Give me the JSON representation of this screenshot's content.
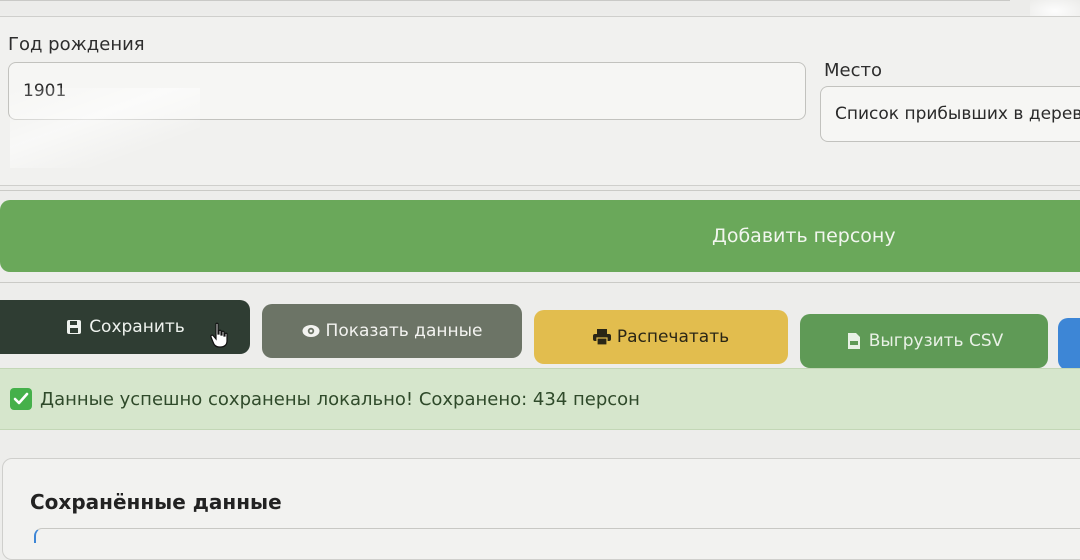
{
  "form": {
    "birth_year_label": "Год рождения",
    "birth_year_value": "1901",
    "place_label": "Место",
    "place_value": "Список прибывших в деревн"
  },
  "actions": {
    "add_person": "Добавить персону",
    "save": "Сохранить",
    "show_data": "Показать данные",
    "print": "Распечатать",
    "export_csv": "Выгрузить CSV"
  },
  "status": {
    "message": "Данные успешно сохранены локально! Сохранено: 434 персон"
  },
  "saved_section": {
    "title": "Сохранённые данные"
  },
  "colors": {
    "add_button": "#6aa85a",
    "save_button": "#2f3d33",
    "show_button": "#6c7466",
    "print_button": "#e2bd4e",
    "csv_button": "#5f9a56",
    "success_bg": "#d6e6cc"
  },
  "icons": {
    "save": "floppy-disk-icon",
    "show": "eye-icon",
    "print": "printer-icon",
    "csv": "csv-file-icon",
    "success": "check-mark-icon",
    "cursor": "hand-pointer-icon"
  }
}
